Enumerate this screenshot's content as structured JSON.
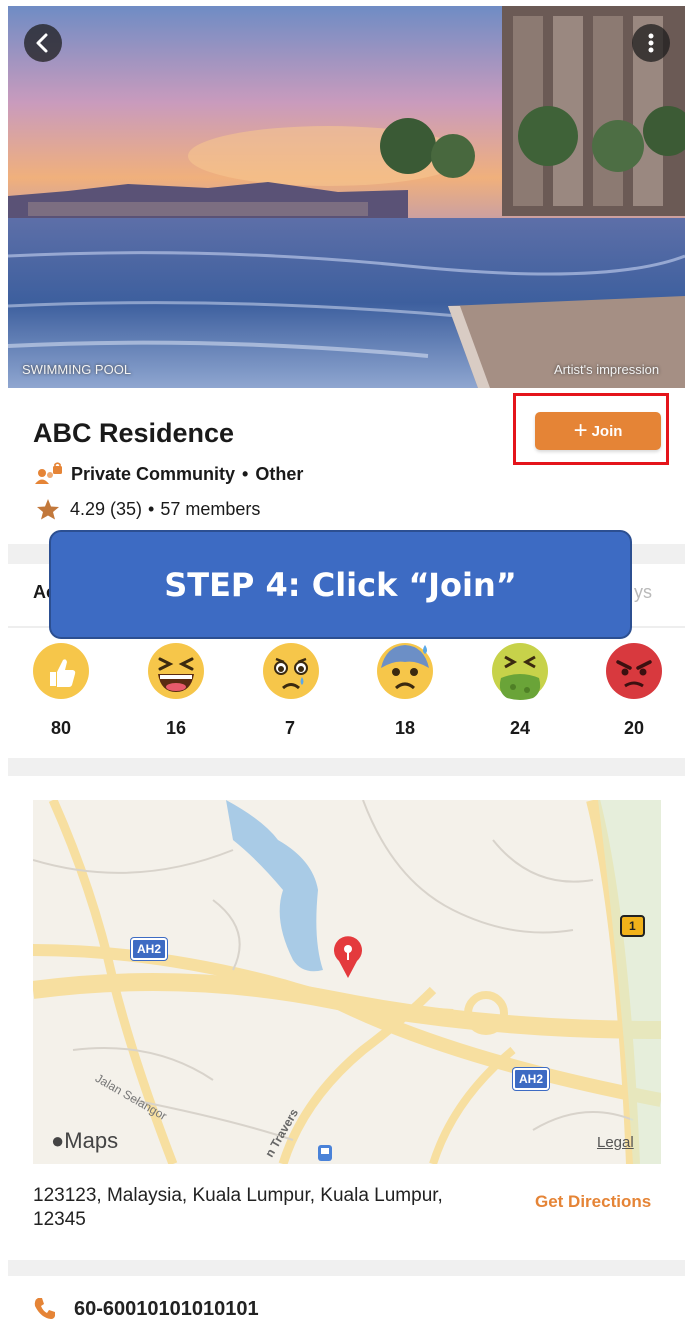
{
  "hero": {
    "caption_left": "SWIMMING POOL",
    "caption_right": "Artist's impression",
    "back_icon": "chevron-left-icon",
    "more_icon": "more-vertical-icon"
  },
  "community": {
    "name": "ABC Residence",
    "type": "Private Community",
    "category": "Other",
    "rating": "4.29 (35)",
    "members": "57 members",
    "join_label": "Join",
    "separator": "•"
  },
  "step_overlay": {
    "text": "STEP 4: Click “Join”"
  },
  "reactions": {
    "header": "Ac",
    "header_right": "ys",
    "items": [
      {
        "icon": "thumbs-up-emoji-icon",
        "count": "80"
      },
      {
        "icon": "laughing-emoji-icon",
        "count": "16"
      },
      {
        "icon": "crying-emoji-icon",
        "count": "7"
      },
      {
        "icon": "anxious-sweat-emoji-icon",
        "count": "18"
      },
      {
        "icon": "nauseated-emoji-icon",
        "count": "24"
      },
      {
        "icon": "angry-emoji-icon",
        "count": "20"
      }
    ]
  },
  "map": {
    "logo": "Maps",
    "legal": "Legal",
    "labels": {
      "highway1": "AH2",
      "highway2": "AH2",
      "route": "1",
      "street1": "Jalan Selangor",
      "street2": "n Travers"
    }
  },
  "address": {
    "text": "123123, Malaysia, Kuala Lumpur, Kuala Lumpur, 12345",
    "directions_label": "Get Directions"
  },
  "contact": {
    "phone": "60-60010101010101"
  },
  "colors": {
    "accent": "#e58436",
    "highlight": "#e4141b",
    "overlay": "#3d6bc3"
  }
}
